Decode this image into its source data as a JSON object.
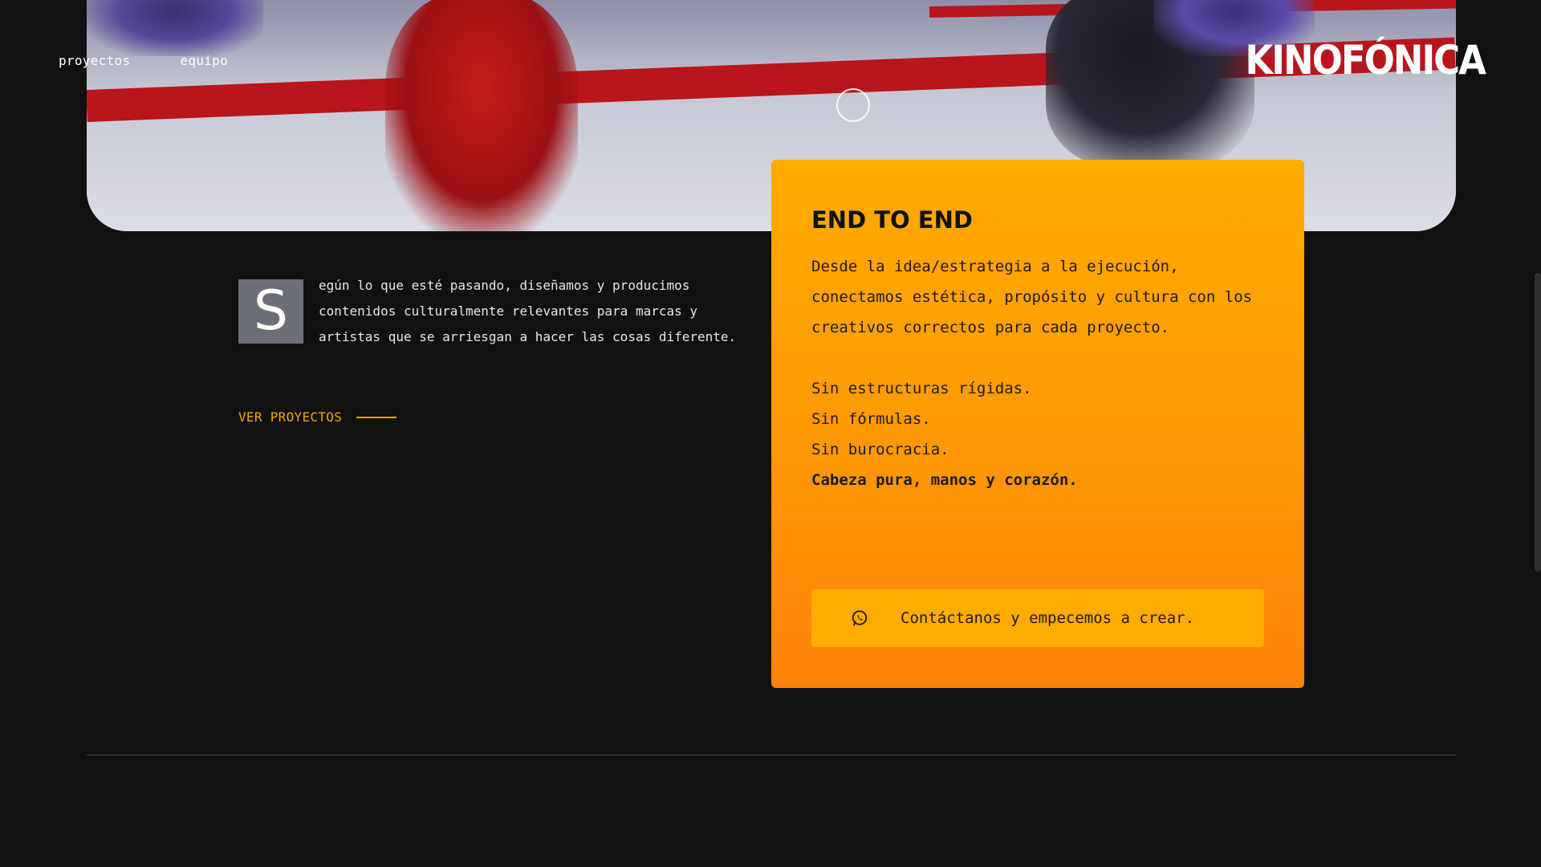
{
  "nav": {
    "items": [
      {
        "label": "proyectos"
      },
      {
        "label": "equipo"
      }
    ]
  },
  "logo": {
    "text": "KINOFÓNICA"
  },
  "intro": {
    "dropcap": "S",
    "text": "egún lo que esté pasando, diseñamos y producimos contenidos culturalmente relevantes para marcas y artistas que se arriesgan a hacer las cosas diferente."
  },
  "ver_proyectos": {
    "label": "VER PROYECTOS"
  },
  "card": {
    "title": "END TO END",
    "paragraph": "Desde la idea/estrategia a la ejecución, conectamos estética, propósito y cultura con los creativos correctos para cada proyecto.",
    "lines": [
      "Sin estructuras rígidas.",
      "Sin fórmulas.",
      "Sin burocracia."
    ],
    "closing": "Cabeza pura, manos y corazón.",
    "cta_label": "Contáctanos y empecemos a crear.",
    "cta_icon": "whatsapp-icon"
  },
  "colors": {
    "accent": "#f5a300",
    "card_top": "#ffab00",
    "card_bottom": "#ff8208",
    "background": "#111111"
  }
}
